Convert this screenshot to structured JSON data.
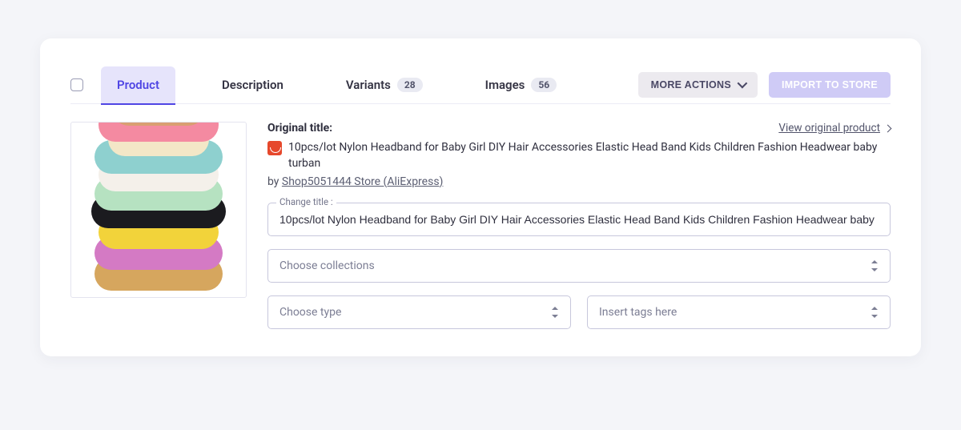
{
  "tabs": {
    "product": "Product",
    "description": "Description",
    "variants": {
      "label": "Variants",
      "count": "28"
    },
    "images": {
      "label": "Images",
      "count": "56"
    }
  },
  "buttons": {
    "more": "MORE ACTIONS",
    "import": "IMPORT TO STORE"
  },
  "original": {
    "label": "Original title:",
    "view_link": "View original product",
    "title": "10pcs/lot Nylon Headband for Baby Girl DIY Hair Accessories Elastic Head Band Kids Children Fashion Headwear baby turban",
    "by_prefix": "by ",
    "store": "Shop5051444 Store (AliExpress)"
  },
  "change_title": {
    "legend": "Change title :",
    "value": "10pcs/lot Nylon Headband for Baby Girl DIY Hair Accessories Elastic Head Band Kids Children Fashion Headwear baby"
  },
  "selects": {
    "collections": "Choose collections",
    "type": "Choose type",
    "tags": "Insert tags here"
  }
}
